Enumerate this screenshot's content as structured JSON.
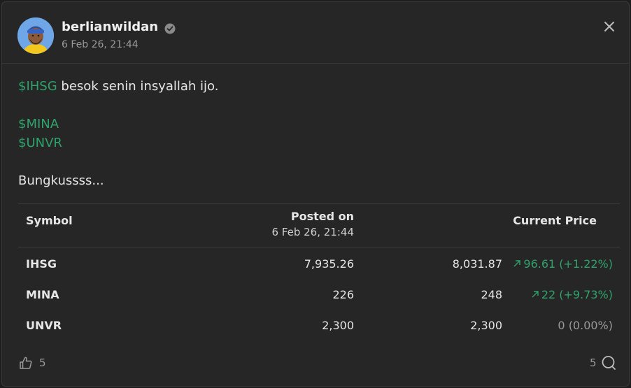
{
  "author": {
    "username": "berlianwildan",
    "timestamp": "6 Feb 26, 21:44"
  },
  "post": {
    "line1_ticker": "$IHSG",
    "line1_text": " besok senin insyallah ijo.",
    "ticker2": "$MINA",
    "ticker3": "$UNVR",
    "closing": "Bungkussss..."
  },
  "table": {
    "headers": {
      "symbol": "Symbol",
      "posted_on": "Posted on",
      "posted_on_date": "6 Feb 26, 21:44",
      "current_price": "Current Price"
    },
    "rows": [
      {
        "symbol": "IHSG",
        "posted": "7,935.26",
        "current": "8,031.87",
        "change": "96.61 (+1.22%)",
        "direction": "up"
      },
      {
        "symbol": "MINA",
        "posted": "226",
        "current": "248",
        "change": "22 (+9.73%)",
        "direction": "up"
      },
      {
        "symbol": "UNVR",
        "posted": "2,300",
        "current": "2,300",
        "change": "0 (0.00%)",
        "direction": "flat"
      }
    ]
  },
  "footer": {
    "likes": "5",
    "comments": "5"
  },
  "colors": {
    "accent_green": "#2ea36b",
    "background": "#262626",
    "muted": "#9a9a9a"
  },
  "icons": {
    "verified": "verified-badge-icon",
    "close": "close-icon",
    "like": "thumbs-up-icon",
    "comment": "comment-bubble-icon",
    "arrow_up": "arrow-up-right-icon"
  }
}
